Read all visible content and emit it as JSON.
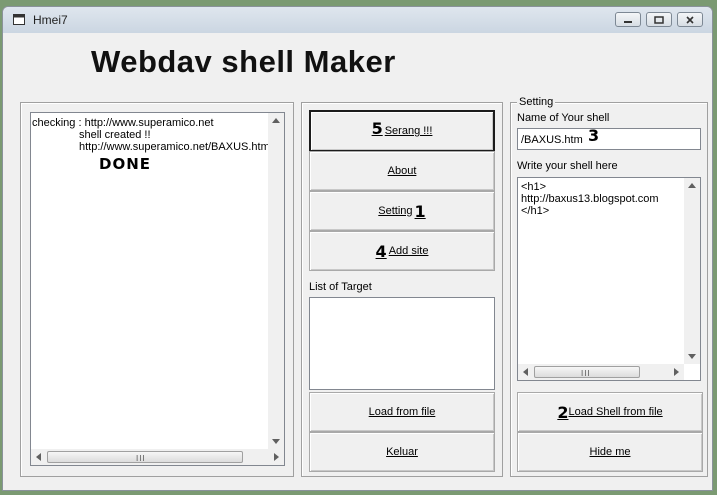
{
  "window": {
    "title": "Hmei7"
  },
  "heading": "Webdav shell Maker",
  "log": {
    "line1": "checking : http://www.superamico.net",
    "line2": "shell created !!",
    "line3": "http://www.superamico.net/BAXUS.htm",
    "stamp": "DONE"
  },
  "buttons": {
    "serang": {
      "num": "5",
      "label": "Serang !!!"
    },
    "about": {
      "label": "About"
    },
    "setting": {
      "label": "Setting",
      "num": "1"
    },
    "add_site": {
      "num": "4",
      "label": "Add site"
    },
    "load_file": {
      "label": "Load from file"
    },
    "keluar": {
      "label": "Keluar"
    },
    "load_shell": {
      "num": "2",
      "label": "Load Shell from file"
    },
    "hide": {
      "label": "Hide me"
    }
  },
  "target": {
    "label": "List of Target"
  },
  "setting": {
    "title": "Setting",
    "name_label": "Name of Your shell",
    "name_value": "/BAXUS.htm",
    "name_num": "3",
    "shell_label": "Write your shell here",
    "shell_line1": "<h1>",
    "shell_line2": "http://baxus13.blogspot.com",
    "shell_line3": "</h1>"
  },
  "scrollbar_grip": "III",
  "icons": [
    "app-window-icon",
    "minimize-icon",
    "maximize-icon",
    "close-icon",
    "scroll-left-icon",
    "scroll-right-icon",
    "scroll-up-icon",
    "scroll-down-icon"
  ]
}
